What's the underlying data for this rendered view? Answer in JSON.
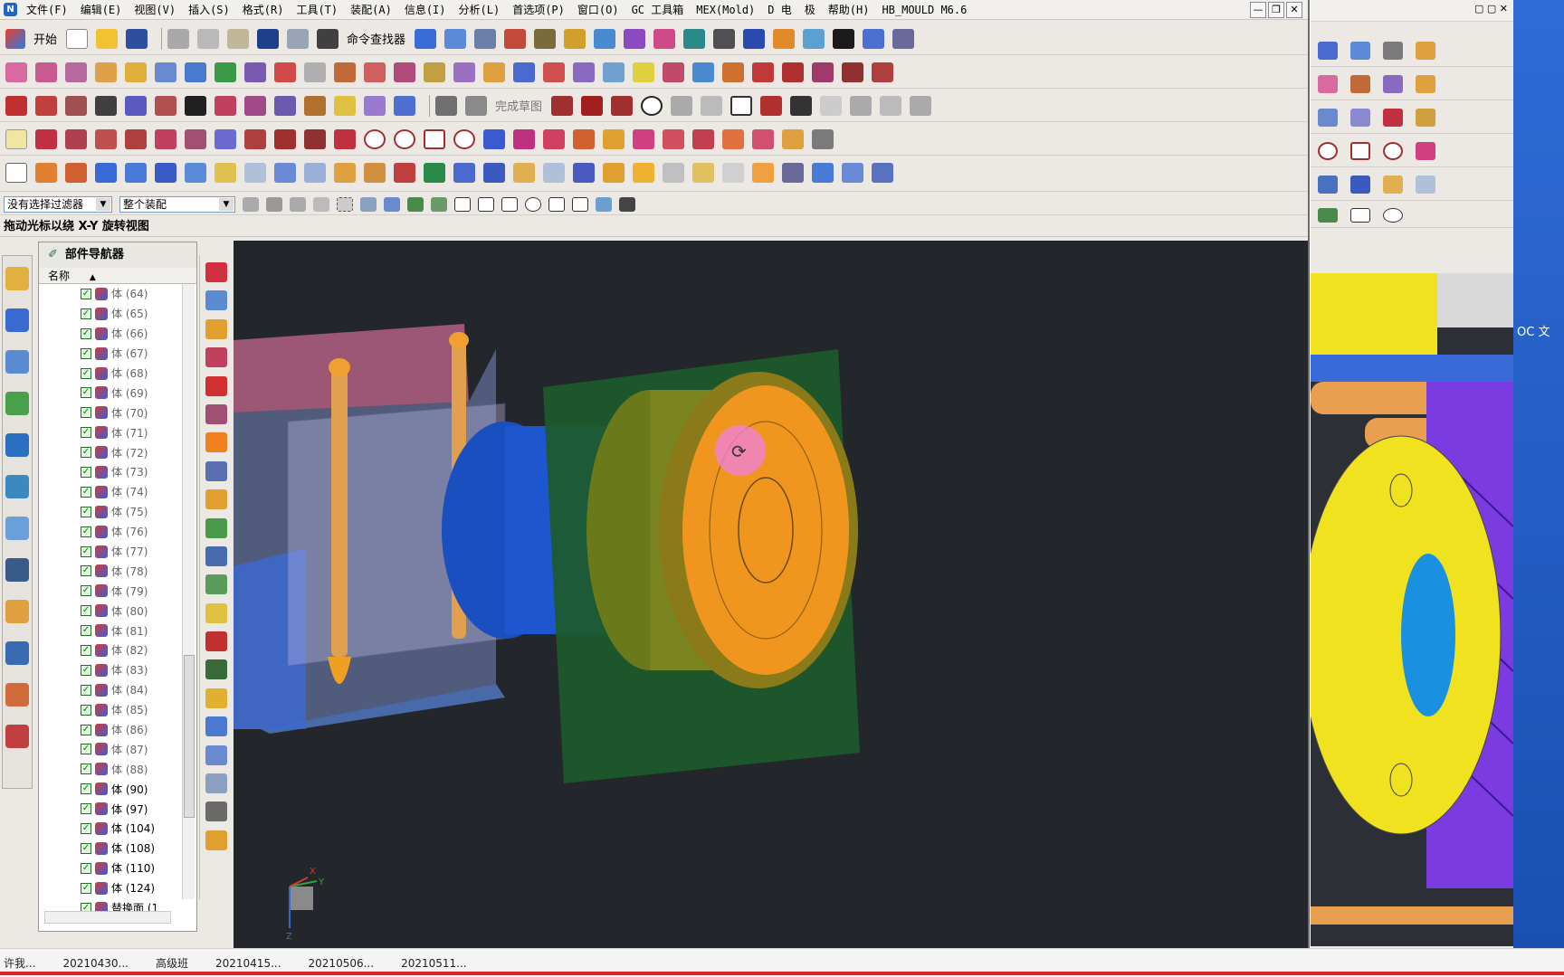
{
  "app": {
    "icon": "nx-app-icon"
  },
  "menu": {
    "items": [
      "文件(F)",
      "编辑(E)",
      "视图(V)",
      "插入(S)",
      "格式(R)",
      "工具(T)",
      "装配(A)",
      "信息(I)",
      "分析(L)",
      "首选项(P)",
      "窗口(O)",
      "GC 工具箱",
      "MEX(Mold)",
      "D 电",
      "极",
      "帮助(H)",
      "HB_MOULD M6.6"
    ]
  },
  "window_buttons": {
    "minimize": "—",
    "restore": "❐",
    "close": "✕"
  },
  "toolbar": {
    "start_label": "开始",
    "command_finder_label": "命令查找器",
    "finish_sketch_label": "完成草图"
  },
  "filter": {
    "selection_filter": "没有选择过滤器",
    "assembly_scope": "整个装配"
  },
  "cue_line": "拖动光标以绕 X-Y 旋转视图",
  "navigator": {
    "title": "部件导航器",
    "column_name": "名称",
    "rows": [
      "体 (64)",
      "体 (65)",
      "体 (66)",
      "体 (67)",
      "体 (68)",
      "体 (69)",
      "体 (70)",
      "体 (71)",
      "体 (72)",
      "体 (73)",
      "体 (74)",
      "体 (75)",
      "体 (76)",
      "体 (77)",
      "体 (78)",
      "体 (79)",
      "体 (80)",
      "体 (81)",
      "体 (82)",
      "体 (83)",
      "体 (84)",
      "体 (85)",
      "体 (86)",
      "体 (87)",
      "体 (88)",
      "体 (90)",
      "体 (97)",
      "体 (104)",
      "体 (108)",
      "体 (110)",
      "体 (124)",
      "替换面 (1"
    ]
  },
  "triad": {
    "x": "X",
    "y": "Y",
    "z": "Z"
  },
  "right_window": {
    "side_text": "OC 文"
  },
  "taskbar": {
    "items": [
      "许我...",
      "20210430...",
      "高级班",
      "20210415...",
      "20210506...",
      "20210511..."
    ]
  },
  "colors": {
    "viewport_bg": "#23262b",
    "orange": "#f0961e",
    "green_plate": "#1d5a2a",
    "blue": "#1a4fc0",
    "yellow": "#f0e21e",
    "purple": "#7a3ce0"
  }
}
